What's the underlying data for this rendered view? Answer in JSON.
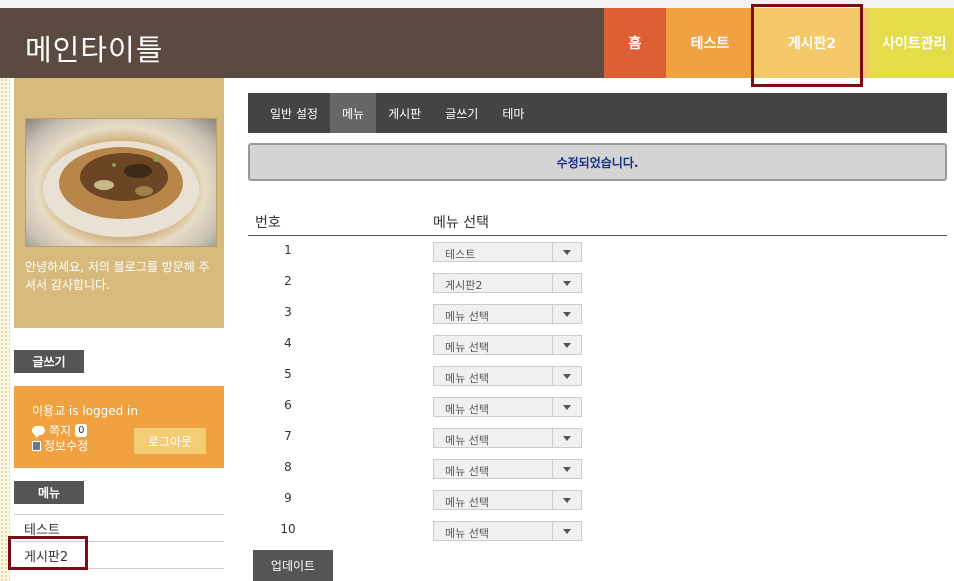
{
  "header": {
    "site_title": "메인타이틀",
    "nav": [
      {
        "label": "홈"
      },
      {
        "label": "테스트"
      },
      {
        "label": "게시판2"
      },
      {
        "label": "사이트관리"
      }
    ]
  },
  "profile": {
    "greeting": "안녕하세요, 저의 블로그를 방문해 주셔서 감사합니다.",
    "tilde": "~"
  },
  "sidebar": {
    "write_label": "글쓰기",
    "login": {
      "logged_in": "이용교 is logged in",
      "message_label": "쪽지",
      "message_count": "0",
      "edit_info": "정보수정",
      "logout": "로그아웃"
    },
    "menu_label": "메뉴",
    "menu_items": [
      {
        "label": "테스트"
      },
      {
        "label": "게시판2"
      }
    ]
  },
  "admin": {
    "tabs": [
      {
        "label": "일반 설정",
        "active": false
      },
      {
        "label": "메뉴",
        "active": true
      },
      {
        "label": "게시판",
        "active": false
      },
      {
        "label": "글쓰기",
        "active": false
      },
      {
        "label": "테마",
        "active": false
      }
    ],
    "notice": "수정되었습니다.",
    "table": {
      "col_num": "번호",
      "col_menu": "메뉴 선택",
      "rows": [
        {
          "num": "1",
          "value": "테스트"
        },
        {
          "num": "2",
          "value": "게시판2"
        },
        {
          "num": "3",
          "value": "메뉴 선택"
        },
        {
          "num": "4",
          "value": "메뉴 선택"
        },
        {
          "num": "5",
          "value": "메뉴 선택"
        },
        {
          "num": "6",
          "value": "메뉴 선택"
        },
        {
          "num": "7",
          "value": "메뉴 선택"
        },
        {
          "num": "8",
          "value": "메뉴 선택"
        },
        {
          "num": "9",
          "value": "메뉴 선택"
        },
        {
          "num": "10",
          "value": "메뉴 선택"
        }
      ]
    },
    "update_button": "업데이트"
  },
  "colors": {
    "header_bg": "#5b4a42",
    "nav_home": "#dc5e33",
    "nav_test": "#f0a142",
    "nav_board2": "#f5c96a",
    "nav_site": "#e5dc4a",
    "highlight": "#7b0c18",
    "notice_text": "#1a2f86"
  }
}
